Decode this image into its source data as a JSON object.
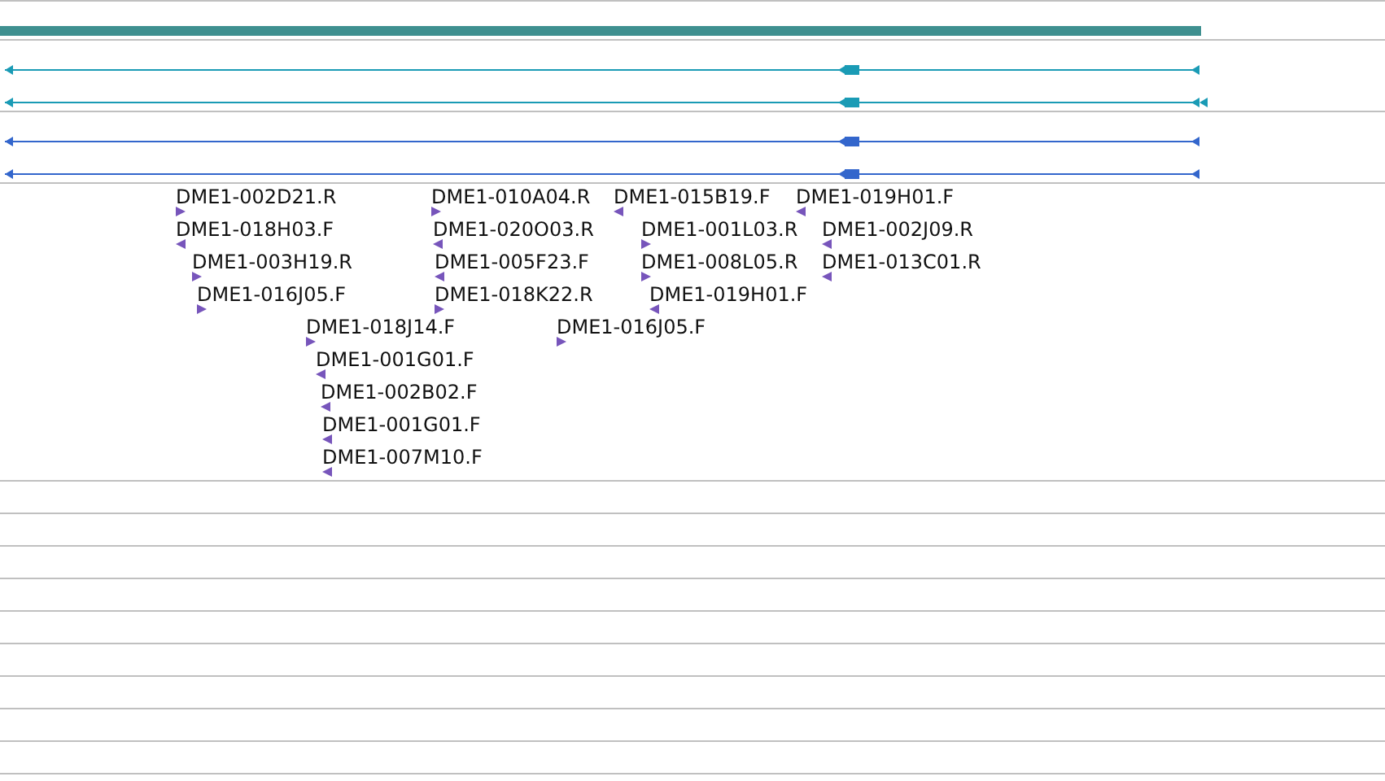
{
  "features": [
    {
      "label": "DME1-002D21.R",
      "reverse": false
    },
    {
      "label": "DME1-010A04.R",
      "reverse": false
    },
    {
      "label": "DME1-015B19.F",
      "reverse": true
    },
    {
      "label": "DME1-019H01.F",
      "reverse": true
    },
    {
      "label": "DME1-018H03.F",
      "reverse": true
    },
    {
      "label": "DME1-020O03.R",
      "reverse": true
    },
    {
      "label": "DME1-001L03.R",
      "reverse": false
    },
    {
      "label": "DME1-002J09.R",
      "reverse": true
    },
    {
      "label": "DME1-003H19.R",
      "reverse": false
    },
    {
      "label": "DME1-005F23.F",
      "reverse": true
    },
    {
      "label": "DME1-008L05.R",
      "reverse": false
    },
    {
      "label": "DME1-013C01.R",
      "reverse": true
    },
    {
      "label": "DME1-016J05.F",
      "reverse": false
    },
    {
      "label": "DME1-018K22.R",
      "reverse": false
    },
    {
      "label": "DME1-019H01.F",
      "reverse": true
    },
    {
      "label": "DME1-018J14.F",
      "reverse": false
    },
    {
      "label": "DME1-016J05.F",
      "reverse": false
    },
    {
      "label": "DME1-001G01.F",
      "reverse": true
    },
    {
      "label": "DME1-002B02.F",
      "reverse": true
    },
    {
      "label": "DME1-001G01.F",
      "reverse": true
    },
    {
      "label": "DME1-007M10.F",
      "reverse": true
    }
  ]
}
